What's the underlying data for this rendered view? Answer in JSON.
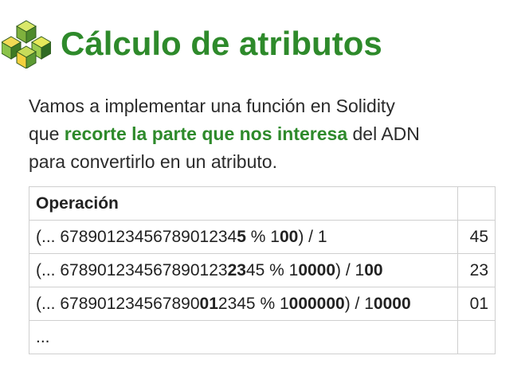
{
  "header": {
    "logo_icon": "green-cubes-logo-icon",
    "title": "Cálculo de atributos"
  },
  "intro": {
    "line1": "Vamos a implementar una función en Solidity",
    "line2_pre": "que ",
    "line2_highlight": "recorte la parte que nos interesa",
    "line2_post": " del ADN",
    "line3": "para convertirlo en un atributo."
  },
  "table": {
    "headers": [
      "Operación",
      ""
    ],
    "rows": [
      {
        "parts": [
          {
            "text": "(... 6789012345678901234",
            "bold": false
          },
          {
            "text": "5",
            "bold": true
          },
          {
            "text": " % 1",
            "bold": false
          },
          {
            "text": "00",
            "bold": true
          },
          {
            "text": ") / 1",
            "bold": false
          }
        ],
        "result": "45"
      },
      {
        "parts": [
          {
            "text": "(... 678901234567890123",
            "bold": false
          },
          {
            "text": "23",
            "bold": true
          },
          {
            "text": "45 % 1",
            "bold": false
          },
          {
            "text": "0000",
            "bold": true
          },
          {
            "text": ") / 1",
            "bold": false
          },
          {
            "text": "00",
            "bold": true
          }
        ],
        "result": "23"
      },
      {
        "parts": [
          {
            "text": "(... 678901234567890",
            "bold": false
          },
          {
            "text": "01",
            "bold": true
          },
          {
            "text": "2345 % 1",
            "bold": false
          },
          {
            "text": "000000",
            "bold": true
          },
          {
            "text": ") / 1",
            "bold": false
          },
          {
            "text": "0000",
            "bold": true
          }
        ],
        "result": "01"
      },
      {
        "parts": [
          {
            "text": "...",
            "bold": false
          }
        ],
        "result": ""
      }
    ]
  },
  "colors": {
    "accent_green": "#2e8a2b",
    "logo_green": "#8bc34a",
    "logo_yellow": "#f4d03f",
    "text": "#222222",
    "border": "#cfcfcf"
  }
}
